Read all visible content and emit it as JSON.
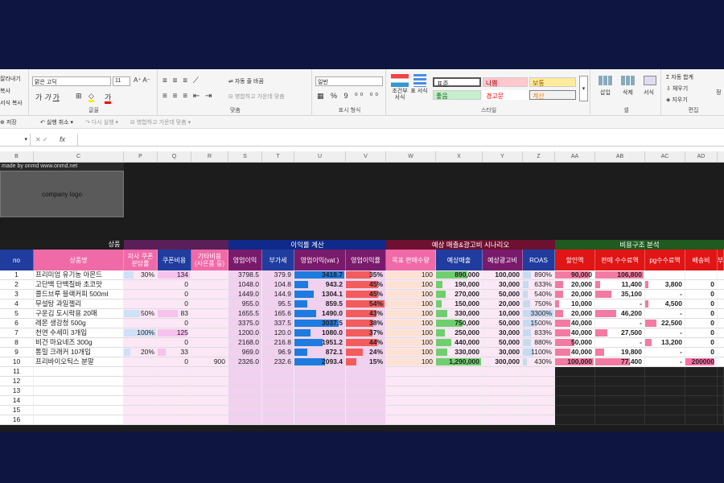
{
  "ribbon": {
    "clipboard": [
      "잘라내기",
      "복사",
      "서식 복사"
    ],
    "font_name": "맑은 고딕",
    "font_size": "11",
    "font_group": "글꼴",
    "align_group": "맞춤",
    "wrap_text": "자동 줄 바꿈",
    "merge": "병합하고 가운데 맞춤",
    "number_format": "일반",
    "number_group": "표시 형식",
    "cond_format": "조건부 서식",
    "table_format": "표 서식",
    "styles": {
      "normal": "표준",
      "bad": "나쁨",
      "neutral": "보통",
      "good": "좋음",
      "warning": "경고문",
      "calc": "계산"
    },
    "style_group": "스타일",
    "insert": "삽입",
    "delete": "삭제",
    "format": "서식",
    "cells_group": "셀",
    "autosum": "자동 합계",
    "fill": "채우기",
    "clear": "지우기",
    "sort": "정",
    "edit_group": "편집"
  },
  "qat": {
    "save": "저장",
    "undo": "실행 취소",
    "redo": "다시 실행",
    "merge": "병합하고 가운데 맞춤"
  },
  "formula": {
    "fx": "fx",
    "value": ""
  },
  "columns": [
    "B",
    "C",
    "P",
    "Q",
    "R",
    "S",
    "T",
    "U",
    "V",
    "W",
    "X",
    "Y",
    "Z",
    "AA",
    "AB",
    "AC",
    "AD"
  ],
  "top": {
    "made_by": "made by onmd www.onmd.net",
    "logo": "company logo"
  },
  "groups": {
    "product": "상품",
    "profit": "이익률 계산",
    "scenario": "예상 매출&광고비 시나리오",
    "cost": "비용구조 분석"
  },
  "headers": [
    "no",
    "상품명",
    "자사 쿠폰\n분담률",
    "쿠폰비용",
    "기타비용\n(사은품 등)",
    "영업이익",
    "부가세",
    "영업이익(vat )",
    "영업이익률",
    "목표 판매수량",
    "예상매출",
    "예상광고비",
    "ROAS",
    "할인액",
    "판매 수수료액",
    "pg수수료액",
    "배송비",
    "부"
  ],
  "rows": [
    {
      "no": "1",
      "name": "프리미엄 유기농 아몬드",
      "coupon_rate": "30%",
      "coupon_cost": "134",
      "etc": "",
      "op": "3798.5",
      "vat": "379.9",
      "opvat": "3418.7",
      "margin": "35%",
      "qty": "100",
      "sales": "890,000",
      "ad": "100,000",
      "roas": "890%",
      "disc": "90,000",
      "fee": "106,800",
      "pg": "",
      "ship": ""
    },
    {
      "no": "2",
      "name": "고단백 단백질바 초코맛",
      "coupon_rate": "",
      "coupon_cost": "0",
      "etc": "",
      "op": "1048.0",
      "vat": "104.8",
      "opvat": "943.2",
      "margin": "45%",
      "qty": "100",
      "sales": "190,000",
      "ad": "30,000",
      "roas": "633%",
      "disc": "20,000",
      "fee": "11,400",
      "pg": "3,800",
      "ship": "0"
    },
    {
      "no": "3",
      "name": "콜드브루 블랙커피 500ml",
      "coupon_rate": "",
      "coupon_cost": "0",
      "etc": "",
      "op": "1449.0",
      "vat": "144.9",
      "opvat": "1304.1",
      "margin": "45%",
      "qty": "100",
      "sales": "270,000",
      "ad": "50,000",
      "roas": "540%",
      "disc": "20,000",
      "fee": "35,100",
      "pg": "-",
      "ship": "0"
    },
    {
      "no": "4",
      "name": "무설탕 과일젤리",
      "coupon_rate": "",
      "coupon_cost": "0",
      "etc": "",
      "op": "955.0",
      "vat": "95.5",
      "opvat": "859.5",
      "margin": "54%",
      "qty": "100",
      "sales": "150,000",
      "ad": "20,000",
      "roas": "750%",
      "disc": "10,000",
      "fee": "-",
      "pg": "4,500",
      "ship": "0"
    },
    {
      "no": "5",
      "name": "구운김 도시락용 20매",
      "coupon_rate": "50%",
      "coupon_cost": "83",
      "etc": "",
      "op": "1655.5",
      "vat": "165.6",
      "opvat": "1490.0",
      "margin": "43%",
      "qty": "100",
      "sales": "330,000",
      "ad": "10,000",
      "roas": "3300%",
      "disc": "20,000",
      "fee": "46,200",
      "pg": "-",
      "ship": "0"
    },
    {
      "no": "6",
      "name": "레몬 생강청 500g",
      "coupon_rate": "",
      "coupon_cost": "0",
      "etc": "",
      "op": "3375.0",
      "vat": "337.5",
      "opvat": "3037.5",
      "margin": "38%",
      "qty": "100",
      "sales": "750,000",
      "ad": "50,000",
      "roas": "1500%",
      "disc": "40,000",
      "fee": "-",
      "pg": "22,500",
      "ship": "0"
    },
    {
      "no": "7",
      "name": "천연 수세미 3개입",
      "coupon_rate": "100%",
      "coupon_cost": "125",
      "etc": "",
      "op": "1200.0",
      "vat": "120.0",
      "opvat": "1080.0",
      "margin": "37%",
      "qty": "100",
      "sales": "250,000",
      "ad": "30,000",
      "roas": "833%",
      "disc": "40,000",
      "fee": "27,500",
      "pg": "-",
      "ship": "0"
    },
    {
      "no": "8",
      "name": "비건 마요네즈 300g",
      "coupon_rate": "",
      "coupon_cost": "0",
      "etc": "",
      "op": "2168.0",
      "vat": "216.8",
      "opvat": "1951.2",
      "margin": "44%",
      "qty": "100",
      "sales": "440,000",
      "ad": "50,000",
      "roas": "880%",
      "disc": "50,000",
      "fee": "-",
      "pg": "13,200",
      "ship": "0"
    },
    {
      "no": "9",
      "name": "통밀 크래커 10개입",
      "coupon_rate": "20%",
      "coupon_cost": "33",
      "etc": "",
      "op": "969.0",
      "vat": "96.9",
      "opvat": "872.1",
      "margin": "24%",
      "qty": "100",
      "sales": "330,000",
      "ad": "30,000",
      "roas": "1100%",
      "disc": "40,000",
      "fee": "19,800",
      "pg": "-",
      "ship": "0"
    },
    {
      "no": "10",
      "name": "프리바이오틱스 분말",
      "coupon_rate": "",
      "coupon_cost": "0",
      "etc": "900",
      "op": "2326.0",
      "vat": "232.6",
      "opvat": "2093.4",
      "margin": "15%",
      "qty": "100",
      "sales": "1,290,000",
      "ad": "300,000",
      "roas": "430%",
      "disc": "100,000",
      "fee": "77,400",
      "pg": "-",
      "ship": "200000"
    }
  ],
  "empty_rows": [
    "11",
    "12",
    "13",
    "14",
    "15",
    "16"
  ]
}
